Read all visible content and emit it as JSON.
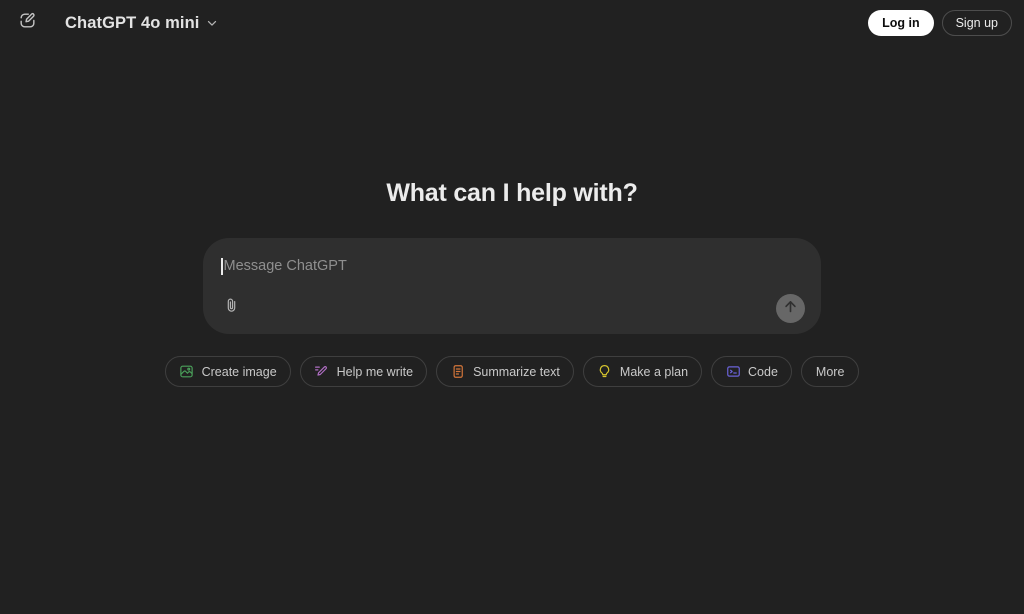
{
  "topbar": {
    "compose_icon": "compose-new-chat-icon",
    "model_name": "ChatGPT 4o mini",
    "chevron_icon": "chevron-down-icon",
    "login_label": "Log in",
    "signup_label": "Sign up"
  },
  "main": {
    "headline": "What can I help with?"
  },
  "composer": {
    "placeholder": "Message ChatGPT",
    "value": "",
    "attach_icon": "paperclip-icon",
    "send_icon": "arrow-up-icon"
  },
  "suggestions": [
    {
      "label": "Create image",
      "icon": "image-icon",
      "color": "#4ba15b"
    },
    {
      "label": "Help me write",
      "icon": "pencil-icon",
      "color": "#b06ec4"
    },
    {
      "label": "Summarize text",
      "icon": "document-icon",
      "color": "#d4763a"
    },
    {
      "label": "Make a plan",
      "icon": "lightbulb-icon",
      "color": "#d6c52e"
    },
    {
      "label": "Code",
      "icon": "terminal-icon",
      "color": "#6a62d8"
    },
    {
      "label": "More",
      "icon": "",
      "color": ""
    }
  ],
  "colors": {
    "page_bg": "#212121",
    "composer_bg": "#2f2f2f",
    "text_primary": "#ececec",
    "text_muted": "#8f8f8f",
    "login_bg": "#ffffff",
    "send_bg": "#676767"
  }
}
